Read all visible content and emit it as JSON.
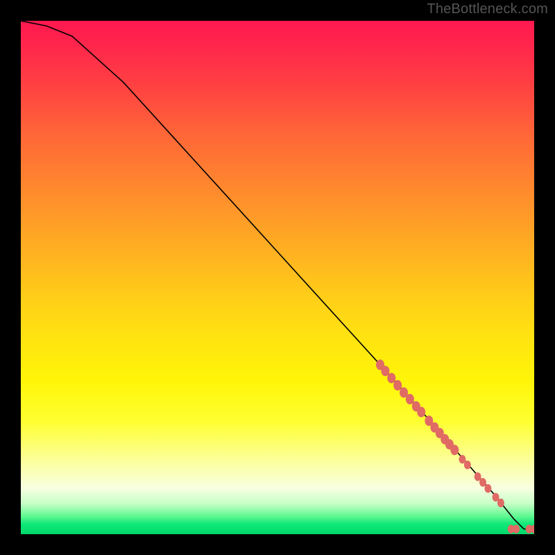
{
  "watermark": "TheBottleneck.com",
  "chart_data": {
    "type": "line",
    "title": "",
    "xlabel": "",
    "ylabel": "",
    "xlim": [
      0,
      100
    ],
    "ylim": [
      0,
      100
    ],
    "grid": false,
    "legend": false,
    "series": [
      {
        "name": "curve",
        "x": [
          0,
          5,
          10,
          20,
          30,
          40,
          50,
          60,
          70,
          78,
          85,
          92,
          96,
          98,
          100
        ],
        "values": [
          100,
          99,
          97,
          88,
          77,
          66,
          55,
          44,
          33,
          24,
          16,
          8,
          3,
          1,
          1
        ]
      }
    ],
    "markers": {
      "name": "highlighted-points",
      "color": "#e06a64",
      "points": [
        {
          "x": 70.0,
          "y": 33.0,
          "r": 6
        },
        {
          "x": 71.0,
          "y": 31.8,
          "r": 6
        },
        {
          "x": 72.2,
          "y": 30.4,
          "r": 6
        },
        {
          "x": 73.4,
          "y": 29.0,
          "r": 6
        },
        {
          "x": 74.6,
          "y": 27.6,
          "r": 6
        },
        {
          "x": 75.8,
          "y": 26.3,
          "r": 6
        },
        {
          "x": 77.0,
          "y": 24.9,
          "r": 6
        },
        {
          "x": 78.0,
          "y": 23.8,
          "r": 6
        },
        {
          "x": 79.5,
          "y": 22.1,
          "r": 6
        },
        {
          "x": 80.6,
          "y": 20.8,
          "r": 6
        },
        {
          "x": 81.6,
          "y": 19.7,
          "r": 6
        },
        {
          "x": 82.6,
          "y": 18.5,
          "r": 6
        },
        {
          "x": 83.5,
          "y": 17.5,
          "r": 6
        },
        {
          "x": 84.5,
          "y": 16.4,
          "r": 6
        },
        {
          "x": 86.0,
          "y": 14.6,
          "r": 5
        },
        {
          "x": 87.0,
          "y": 13.5,
          "r": 5
        },
        {
          "x": 89.0,
          "y": 11.2,
          "r": 5
        },
        {
          "x": 90.0,
          "y": 10.1,
          "r": 5
        },
        {
          "x": 91.0,
          "y": 8.9,
          "r": 5
        },
        {
          "x": 92.5,
          "y": 7.2,
          "r": 5
        },
        {
          "x": 93.5,
          "y": 6.1,
          "r": 5
        },
        {
          "x": 95.5,
          "y": 1.0,
          "r": 5
        },
        {
          "x": 96.5,
          "y": 1.0,
          "r": 5
        },
        {
          "x": 99.0,
          "y": 1.0,
          "r": 5
        },
        {
          "x": 100.0,
          "y": 1.0,
          "r": 5
        }
      ]
    }
  }
}
